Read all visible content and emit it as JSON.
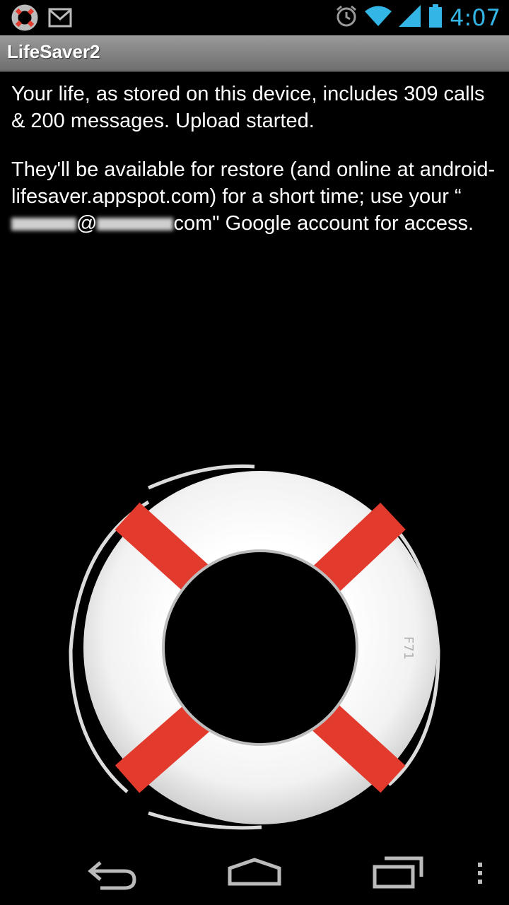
{
  "status_bar": {
    "notification_icons": [
      "lifesaver-icon",
      "gmail-icon"
    ],
    "system_icons": [
      "alarm-icon",
      "wifi-icon",
      "signal-icon",
      "battery-icon"
    ],
    "time": "4:07",
    "accent_color": "#33b5e5"
  },
  "action_bar": {
    "title": "LifeSaver2"
  },
  "message": {
    "paragraph1": "Your life, as stored on this device, includes 309 calls & 200 messages. Upload started.",
    "p2_part1": "They'll be available for restore (and online at android-lifesaver.appspot.com) for a short time; use your “",
    "p2_at": "@",
    "p2_part2": "com\" Google account for access."
  },
  "illustration": {
    "ring_label": "F71",
    "colors": {
      "ring": "#ffffff",
      "bands": "#e23b2e"
    }
  },
  "nav_bar": {
    "buttons": [
      "back-icon",
      "home-icon",
      "recent-apps-icon",
      "overflow-menu-icon"
    ]
  }
}
